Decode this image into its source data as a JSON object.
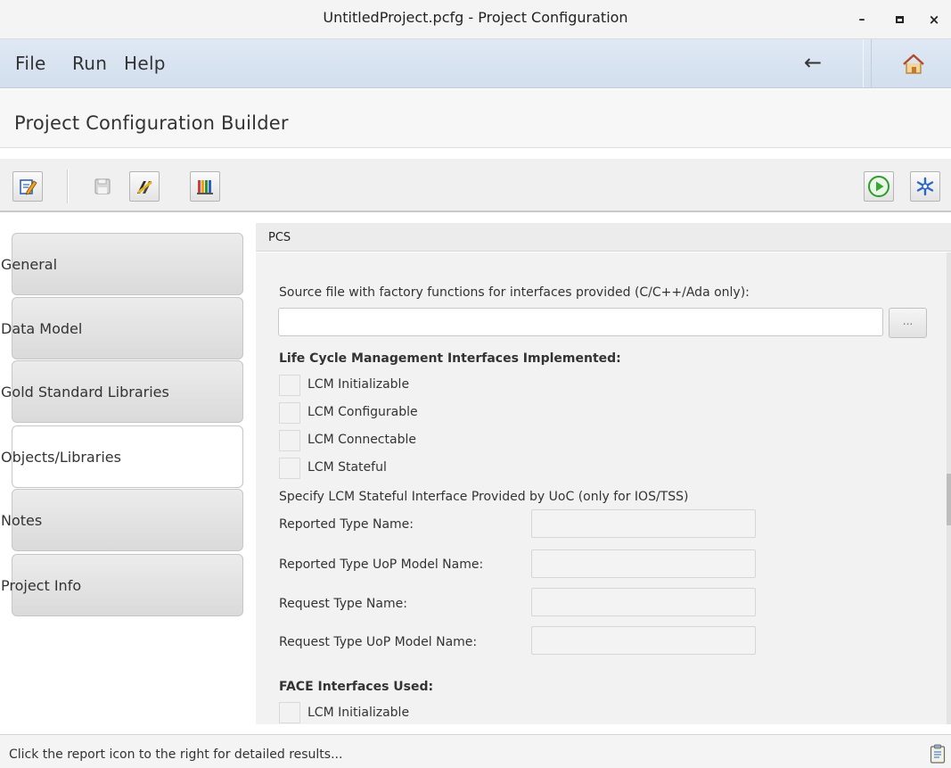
{
  "window": {
    "title": "UntitledProject.pcfg - Project Configuration",
    "min_glyph": "–",
    "close_glyph": "×"
  },
  "menu": {
    "items": [
      {
        "label": "File"
      },
      {
        "label": "Run"
      },
      {
        "label": "Help"
      }
    ],
    "back_glyph": "←"
  },
  "header": {
    "title": "Project Configuration Builder"
  },
  "toolbar": {
    "left_icons": [
      "edit-icon",
      "save-icon",
      "tools-icon",
      "library-icon"
    ],
    "right_icons": [
      "run-icon",
      "snowflake-icon"
    ],
    "save_disabled": true
  },
  "sidebar": {
    "tabs": [
      {
        "label": "General",
        "active": false
      },
      {
        "label": "Data Model",
        "active": false
      },
      {
        "label": "Gold Standard Libraries",
        "active": false
      },
      {
        "label": "Objects/Libraries",
        "active": true
      },
      {
        "label": "Notes",
        "active": false
      },
      {
        "label": "Project Info",
        "active": false
      }
    ]
  },
  "panel": {
    "header": "PCS",
    "source_file_label": "Source file with factory functions for interfaces provided (C/C++/Ada only):",
    "source_file_value": "",
    "browse_label": "...",
    "lcm_heading": "Life Cycle Management Interfaces Implemented:",
    "lcm_checkboxes": [
      {
        "label": "LCM Initializable",
        "checked": false
      },
      {
        "label": "LCM Configurable",
        "checked": false
      },
      {
        "label": "LCM Connectable",
        "checked": false
      },
      {
        "label": "LCM Stateful",
        "checked": false
      }
    ],
    "stateful_note": "Specify LCM Stateful Interface Provided by UoC (only for IOS/TSS)",
    "fields": [
      {
        "label": "Reported Type Name:",
        "value": ""
      },
      {
        "label": "Reported Type UoP Model Name:",
        "value": ""
      },
      {
        "label": "Request Type Name:",
        "value": ""
      },
      {
        "label": "Request Type UoP Model Name:",
        "value": ""
      }
    ],
    "face_heading": "FACE Interfaces Used:",
    "face_checkboxes": [
      {
        "label": "LCM Initializable",
        "checked": false
      }
    ]
  },
  "status": {
    "message": "Click the report icon to the right for detailed results...",
    "icon": "report-icon"
  }
}
